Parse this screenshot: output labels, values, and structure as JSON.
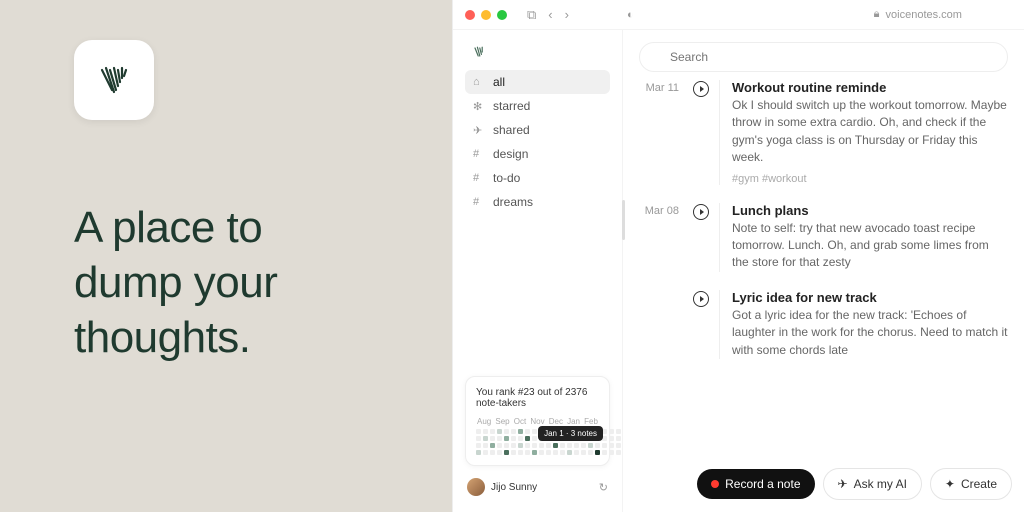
{
  "hero": {
    "tagline": "A place to dump your thoughts."
  },
  "titlebar": {
    "url": "voicenotes.com"
  },
  "sidebar": {
    "items": [
      {
        "icon": "home",
        "label": "all",
        "active": true
      },
      {
        "icon": "star",
        "label": "starred"
      },
      {
        "icon": "send",
        "label": "shared"
      },
      {
        "icon": "hash",
        "label": "design"
      },
      {
        "icon": "hash",
        "label": "to-do"
      },
      {
        "icon": "hash",
        "label": "dreams"
      }
    ],
    "rank": {
      "title": "You rank #23 out of 2376 note-takers",
      "months": [
        "Aug",
        "Sep",
        "Oct",
        "Nov",
        "Dec",
        "Jan",
        "Feb"
      ],
      "tooltip": "Jan 1 · 3 notes"
    },
    "user": {
      "name": "Jijo Sunny"
    }
  },
  "search": {
    "placeholder": "Search"
  },
  "notes": [
    {
      "date": "Mar 11",
      "title": "Workout routine reminde",
      "body": "Ok I should switch up the workout tomorrow. Maybe throw in some extra cardio. Oh, and check if the gym's yoga class is on Thursday or Friday this week.",
      "tags": "#gym   #workout"
    },
    {
      "date": "Mar 08",
      "title": "Lunch plans",
      "body": "Note to self: try that new avocado toast recipe tomorrow. Lunch. Oh, and grab some limes from the store for that zesty"
    },
    {
      "date": "",
      "title": "Lyric idea for new track",
      "body": "Got a lyric idea for the new track: 'Echoes of laughter in the work for the chorus. Need to match it with some chords late"
    }
  ],
  "actions": {
    "record": "Record a note",
    "ask": "Ask my AI",
    "create": "Create"
  }
}
